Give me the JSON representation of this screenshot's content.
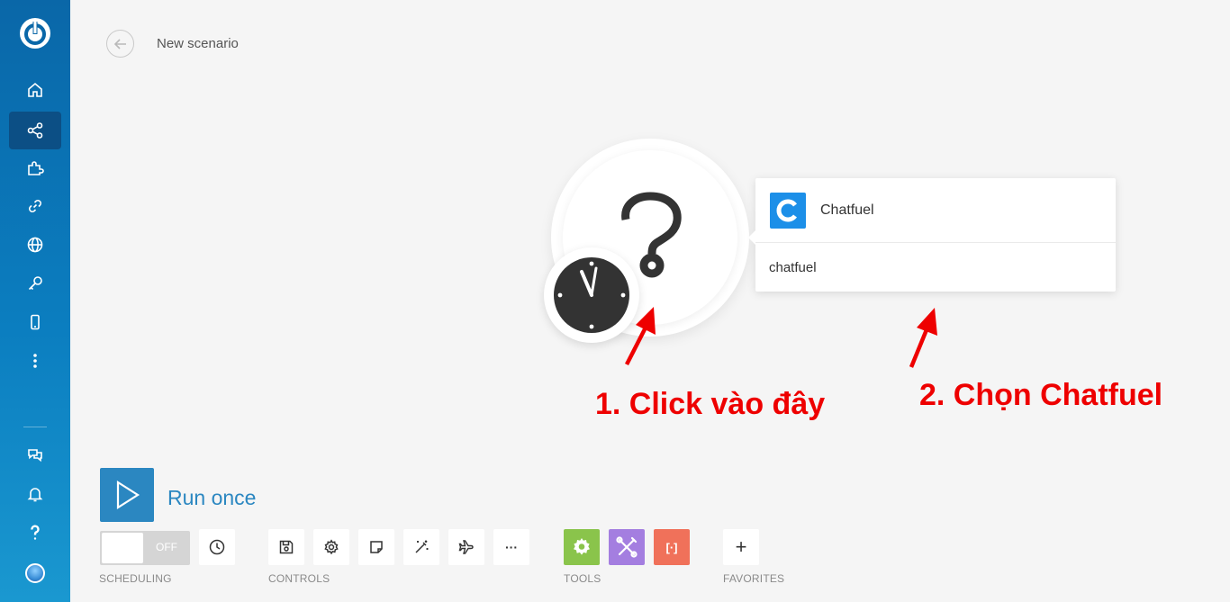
{
  "header": {
    "title": "New scenario"
  },
  "sidebar": {
    "items": [
      {
        "name": "home"
      },
      {
        "name": "scenarios",
        "active": true
      },
      {
        "name": "templates"
      },
      {
        "name": "connections"
      },
      {
        "name": "webhooks"
      },
      {
        "name": "keys"
      },
      {
        "name": "devices"
      },
      {
        "name": "more"
      }
    ],
    "bottom": [
      {
        "name": "help-chat"
      },
      {
        "name": "notifications"
      },
      {
        "name": "help"
      },
      {
        "name": "profile"
      }
    ]
  },
  "module_popup": {
    "app_name": "Chatfuel",
    "search_value": "chatfuel",
    "icon_letter": "C",
    "icon_color": "#1c8fe8"
  },
  "annotations": {
    "step1": "1. Click vào đây",
    "step2": "2. Chọn Chatfuel",
    "color": "#ee0000"
  },
  "toolbar": {
    "run_label": "Run once",
    "toggle_label": "OFF",
    "sections": {
      "scheduling": "SCHEDULING",
      "controls": "CONTROLS",
      "tools": "TOOLS",
      "favorites": "FAVORITES"
    },
    "more_label": "···",
    "tools_label": "[·]",
    "add_label": "+",
    "tool_colors": {
      "gear": "#8ac44b",
      "tools": "#a47ee0",
      "text_parser": "#f0715a"
    }
  },
  "question_mark": "?"
}
